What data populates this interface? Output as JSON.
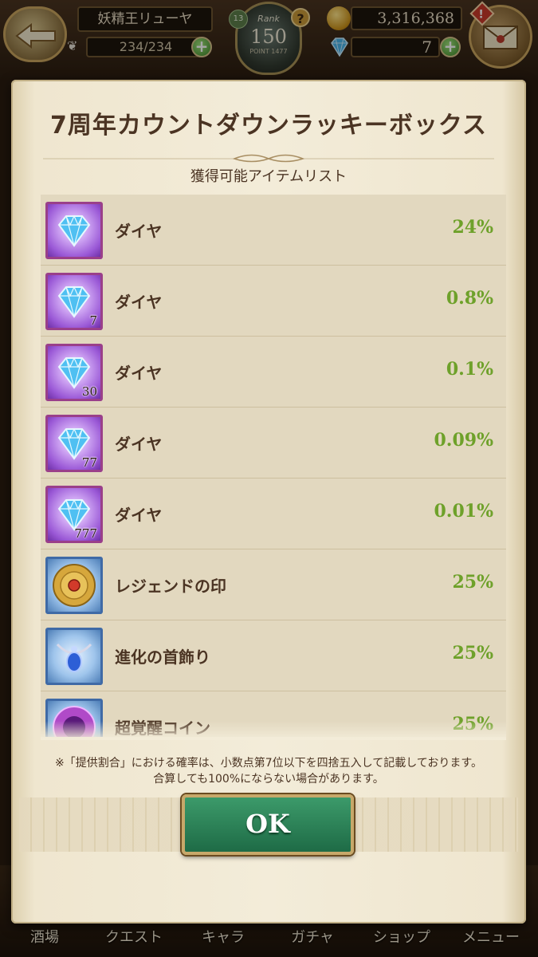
{
  "header": {
    "player_name": "妖精王リューヤ",
    "stamina": "234/234",
    "level_badge": "13",
    "rank_label": "Rank",
    "rank_value": "150",
    "rank_sub": "POINT 1477",
    "help_glyph": "?",
    "gold": "3,316,368",
    "diamonds": "7",
    "alert_glyph": "!"
  },
  "modal": {
    "title": "7周年カウントダウンラッキーボックス",
    "subtitle": "獲得可能アイテムリスト",
    "items": [
      {
        "name": "ダイヤ",
        "rate": "24%",
        "count": "",
        "icon": "diamond-icon"
      },
      {
        "name": "ダイヤ",
        "rate": "0.8%",
        "count": "7",
        "icon": "diamond-icon"
      },
      {
        "name": "ダイヤ",
        "rate": "0.1%",
        "count": "30",
        "icon": "diamond-icon"
      },
      {
        "name": "ダイヤ",
        "rate": "0.09%",
        "count": "77",
        "icon": "diamond-icon"
      },
      {
        "name": "ダイヤ",
        "rate": "0.01%",
        "count": "777",
        "icon": "diamond-icon"
      },
      {
        "name": "レジェンドの印",
        "rate": "25%",
        "count": "",
        "icon": "legend-seal-icon"
      },
      {
        "name": "進化の首飾り",
        "rate": "25%",
        "count": "",
        "icon": "evolution-necklace-icon"
      },
      {
        "name": "超覚醒コイン",
        "rate": "25%",
        "count": "",
        "icon": "awakening-coin-icon"
      }
    ],
    "notice_line1": "※「提供割合」における確率は、小数点第7位以下を四捨五入して記載しております。",
    "notice_line2": "合算しても100%にならない場合があります。",
    "ok_label": "OK"
  },
  "nav": {
    "items": [
      {
        "label": "酒場",
        "icon": "tavern-icon"
      },
      {
        "label": "クエスト",
        "icon": "quest-icon"
      },
      {
        "label": "キャラ",
        "icon": "character-icon"
      },
      {
        "label": "ガチャ",
        "icon": "gacha-icon"
      },
      {
        "label": "ショップ",
        "icon": "shop-icon"
      },
      {
        "label": "メニュー",
        "icon": "menu-icon"
      }
    ]
  },
  "colors": {
    "rate_green": "#6ea12a",
    "title_brown": "#4b3423",
    "ok_green": "#2e8a5a",
    "parchment": "#f3ecd9"
  }
}
